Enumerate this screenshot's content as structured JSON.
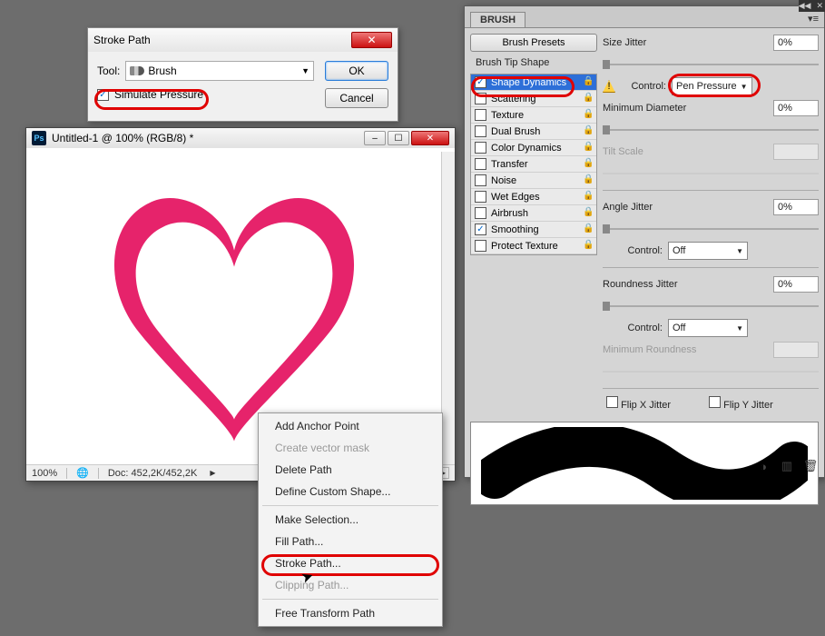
{
  "stroke_dialog": {
    "title": "Stroke Path",
    "tool_label": "Tool:",
    "tool_value": "Brush",
    "simulate_pressure_label": "Simulate Pressure",
    "simulate_pressure_checked": true,
    "ok_label": "OK",
    "cancel_label": "Cancel"
  },
  "doc_window": {
    "title": "Untitled-1 @ 100% (RGB/8) *",
    "zoom": "100%",
    "doc_size": "Doc: 452,2K/452,2K"
  },
  "context_menu": {
    "items": [
      {
        "label": "Add Anchor Point",
        "disabled": false
      },
      {
        "label": "Create vector mask",
        "disabled": true
      },
      {
        "label": "Delete Path",
        "disabled": false
      },
      {
        "label": "Define Custom Shape...",
        "disabled": false
      },
      {
        "sep": true
      },
      {
        "label": "Make Selection...",
        "disabled": false
      },
      {
        "label": "Fill Path...",
        "disabled": false
      },
      {
        "label": "Stroke Path...",
        "disabled": false,
        "highlight": true
      },
      {
        "label": "Clipping Path...",
        "disabled": true
      },
      {
        "sep": true
      },
      {
        "label": "Free Transform Path",
        "disabled": false
      }
    ]
  },
  "brush_panel": {
    "tab": "BRUSH",
    "presets_btn": "Brush Presets",
    "brush_tip_label": "Brush Tip Shape",
    "options": [
      {
        "label": "Shape Dynamics",
        "checked": true,
        "selected": true
      },
      {
        "label": "Scattering",
        "checked": false
      },
      {
        "label": "Texture",
        "checked": false
      },
      {
        "label": "Dual Brush",
        "checked": false
      },
      {
        "label": "Color Dynamics",
        "checked": false
      },
      {
        "label": "Transfer",
        "checked": false
      },
      {
        "label": "Noise",
        "checked": false
      },
      {
        "label": "Wet Edges",
        "checked": false
      },
      {
        "label": "Airbrush",
        "checked": false
      },
      {
        "label": "Smoothing",
        "checked": true
      },
      {
        "label": "Protect Texture",
        "checked": false
      }
    ],
    "size_jitter_label": "Size Jitter",
    "size_jitter_value": "0%",
    "control_label": "Control:",
    "size_control_value": "Pen Pressure",
    "min_diameter_label": "Minimum Diameter",
    "min_diameter_value": "0%",
    "tilt_scale_label": "Tilt Scale",
    "angle_jitter_label": "Angle Jitter",
    "angle_jitter_value": "0%",
    "angle_control_value": "Off",
    "roundness_jitter_label": "Roundness Jitter",
    "roundness_jitter_value": "0%",
    "roundness_control_value": "Off",
    "min_roundness_label": "Minimum Roundness",
    "flip_x_label": "Flip X Jitter",
    "flip_y_label": "Flip Y Jitter"
  }
}
